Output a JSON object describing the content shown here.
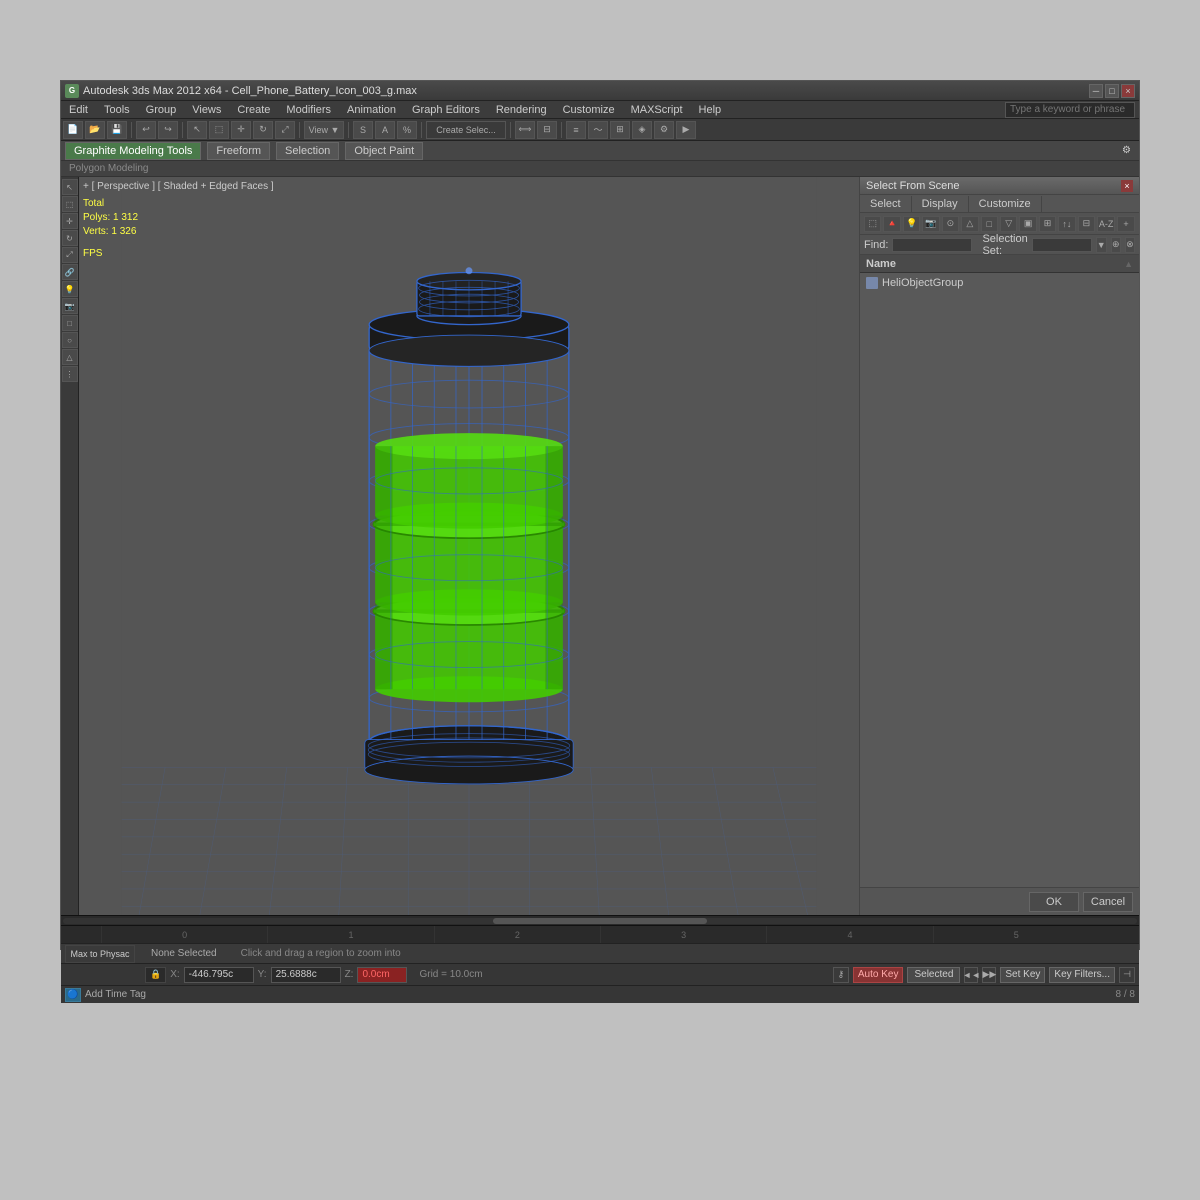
{
  "window": {
    "title": "Autodesk 3ds Max 2012 x64  -  Cell_Phone_Battery_Icon_003_g.max",
    "close_label": "×",
    "min_label": "─",
    "max_label": "□"
  },
  "menu": {
    "items": [
      "Edit",
      "Tools",
      "Group",
      "Views",
      "Create",
      "Modifiers",
      "Animation",
      "Graph Editors",
      "Rendering",
      "Customize",
      "MAXScript",
      "Help"
    ]
  },
  "toolbar1": {
    "search_placeholder": "Type a keyword or phrase"
  },
  "gmt": {
    "tabs": [
      "Graphite Modeling Tools",
      "Freeform",
      "Selection",
      "Object Paint"
    ],
    "active_tab": "Graphite Modeling Tools"
  },
  "viewport": {
    "label": "+ [ Perspective ] [ Shaded + Edged Faces ]",
    "stats": {
      "total_label": "Total",
      "polys_label": "Polys:",
      "polys_value": "1 312",
      "verts_label": "Verts:",
      "verts_value": "1 326",
      "fps_label": "FPS"
    },
    "view_dropdown": "View"
  },
  "scene_panel": {
    "title": "Select From Scene",
    "close_label": "×",
    "tabs": [
      "Select",
      "Display",
      "Customize"
    ],
    "find_label": "Find:",
    "find_placeholder": "",
    "sel_set_label": "Selection Set:",
    "name_header": "Name",
    "objects": [
      {
        "name": "HeliObjectGroup",
        "icon": "group-icon"
      }
    ],
    "ok_label": "OK",
    "cancel_label": "Cancel"
  },
  "status_bar": {
    "none_selected": "None Selected",
    "hint": "Click and drag a region to zoom into"
  },
  "bottom": {
    "max_to_phys": "Max to Physac",
    "coords": {
      "x_label": "X:",
      "x_value": "-446.795c",
      "y_label": "Y:",
      "y_value": "25.6888c",
      "z_label": "Z:",
      "z_value": "0.0cm"
    },
    "grid_label": "Grid = 10.0cm",
    "auto_key": "Auto Key",
    "set_key": "Set Key",
    "selected_label": "Selected",
    "key_filters": "Key Filters...",
    "add_time_tag": "Add Time Tag",
    "timeline_ticks": [
      "0",
      "1",
      "2",
      "3",
      "4",
      "5"
    ],
    "frame_info": "8 / 8"
  },
  "icons": {
    "close": "×",
    "minimize": "─",
    "maximize": "□",
    "arrow_left": "◄",
    "arrow_right": "►",
    "lock": "🔒",
    "cursor": "↖",
    "move": "✛",
    "rotate": "↻",
    "scale": "⤢",
    "undo": "↩",
    "redo": "↪",
    "group_icon": "▣"
  },
  "colors": {
    "background": "#3a3a3a",
    "viewport_bg": "#555555",
    "panel_bg": "#595959",
    "accent_blue": "#4488ff",
    "wireframe": "#4488ff",
    "battery_fill": "#44cc00",
    "grid": "#666666",
    "title_bar": "#4a4a4a",
    "active_green": "#4a7a4a"
  }
}
